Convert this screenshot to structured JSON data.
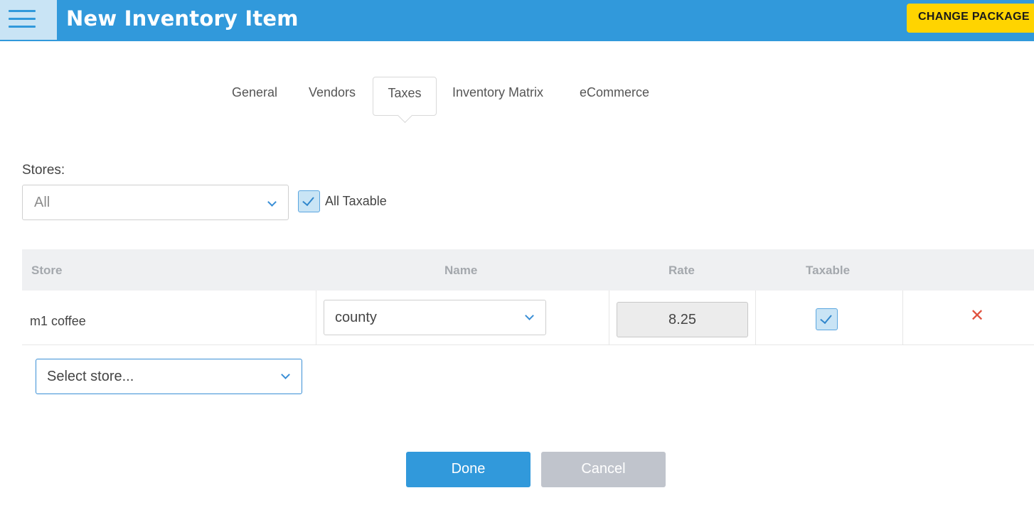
{
  "header": {
    "title": "New Inventory Item",
    "change_package_label": "CHANGE PACKAGE"
  },
  "tabs": [
    {
      "label": "General"
    },
    {
      "label": "Vendors"
    },
    {
      "label": "Taxes",
      "active": true
    },
    {
      "label": "Inventory Matrix"
    },
    {
      "label": "eCommerce"
    }
  ],
  "stores_filter": {
    "label": "Stores:",
    "selected": "All",
    "all_taxable_label": "All Taxable",
    "all_taxable_checked": true
  },
  "table": {
    "columns": [
      "Store",
      "Name",
      "Rate",
      "Taxable"
    ],
    "rows": [
      {
        "store": "m1 coffee",
        "name": "county",
        "rate": "8.25",
        "taxable": true
      }
    ]
  },
  "select_store": {
    "placeholder": "Select store..."
  },
  "footer": {
    "done_label": "Done",
    "cancel_label": "Cancel"
  },
  "colors": {
    "primary": "#3199db",
    "accent_yellow": "#ffd400",
    "delete_red": "#e0523f",
    "cancel_gray": "#c0c4cc"
  }
}
